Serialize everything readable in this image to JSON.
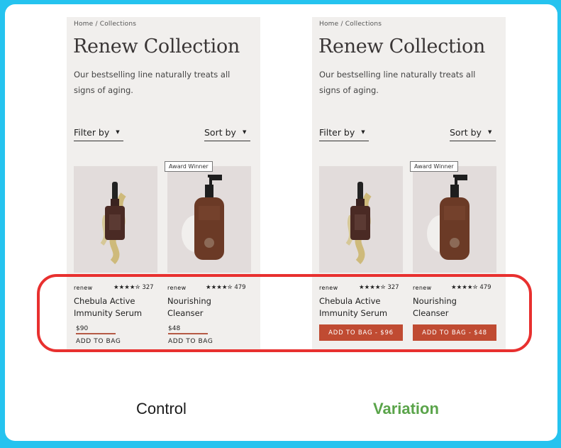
{
  "control": {
    "breadcrumb": "Home / Collections",
    "title": "Renew Collection",
    "subtitle": "Our bestselling line naturally treats all signs of aging.",
    "filter_label": "Filter by",
    "sort_label": "Sort by",
    "badge": "Award Winner",
    "products": [
      {
        "brand": "renew",
        "stars": "★★★★✮",
        "reviews": "327",
        "name": "Chebula Active Immunity Serum",
        "price": "$90",
        "cta": "ADD TO BAG"
      },
      {
        "brand": "renew",
        "stars": "★★★★✮",
        "reviews": "479",
        "name": "Nourishing Cleanser",
        "price": "$48",
        "cta": "ADD TO BAG"
      }
    ]
  },
  "variation": {
    "breadcrumb": "Home / Collections",
    "title": "Renew Collection",
    "subtitle": "Our bestselling line naturally treats all signs of aging.",
    "filter_label": "Filter by",
    "sort_label": "Sort by",
    "badge": "Award Winner",
    "products": [
      {
        "brand": "renew",
        "stars": "★★★★✮",
        "reviews": "327",
        "name": "Chebula Active Immunity Serum",
        "cta": "ADD TO BAG - $96"
      },
      {
        "brand": "renew",
        "stars": "★★★★✮",
        "reviews": "479",
        "name": "Nourishing Cleanser",
        "cta": "ADD TO BAG - $48"
      }
    ]
  },
  "labels": {
    "control": "Control",
    "variation": "Variation"
  },
  "colors": {
    "background": "#25c3ef",
    "cta": "#c04b32",
    "highlight": "#e8302f",
    "variation_label": "#5aa44a"
  }
}
